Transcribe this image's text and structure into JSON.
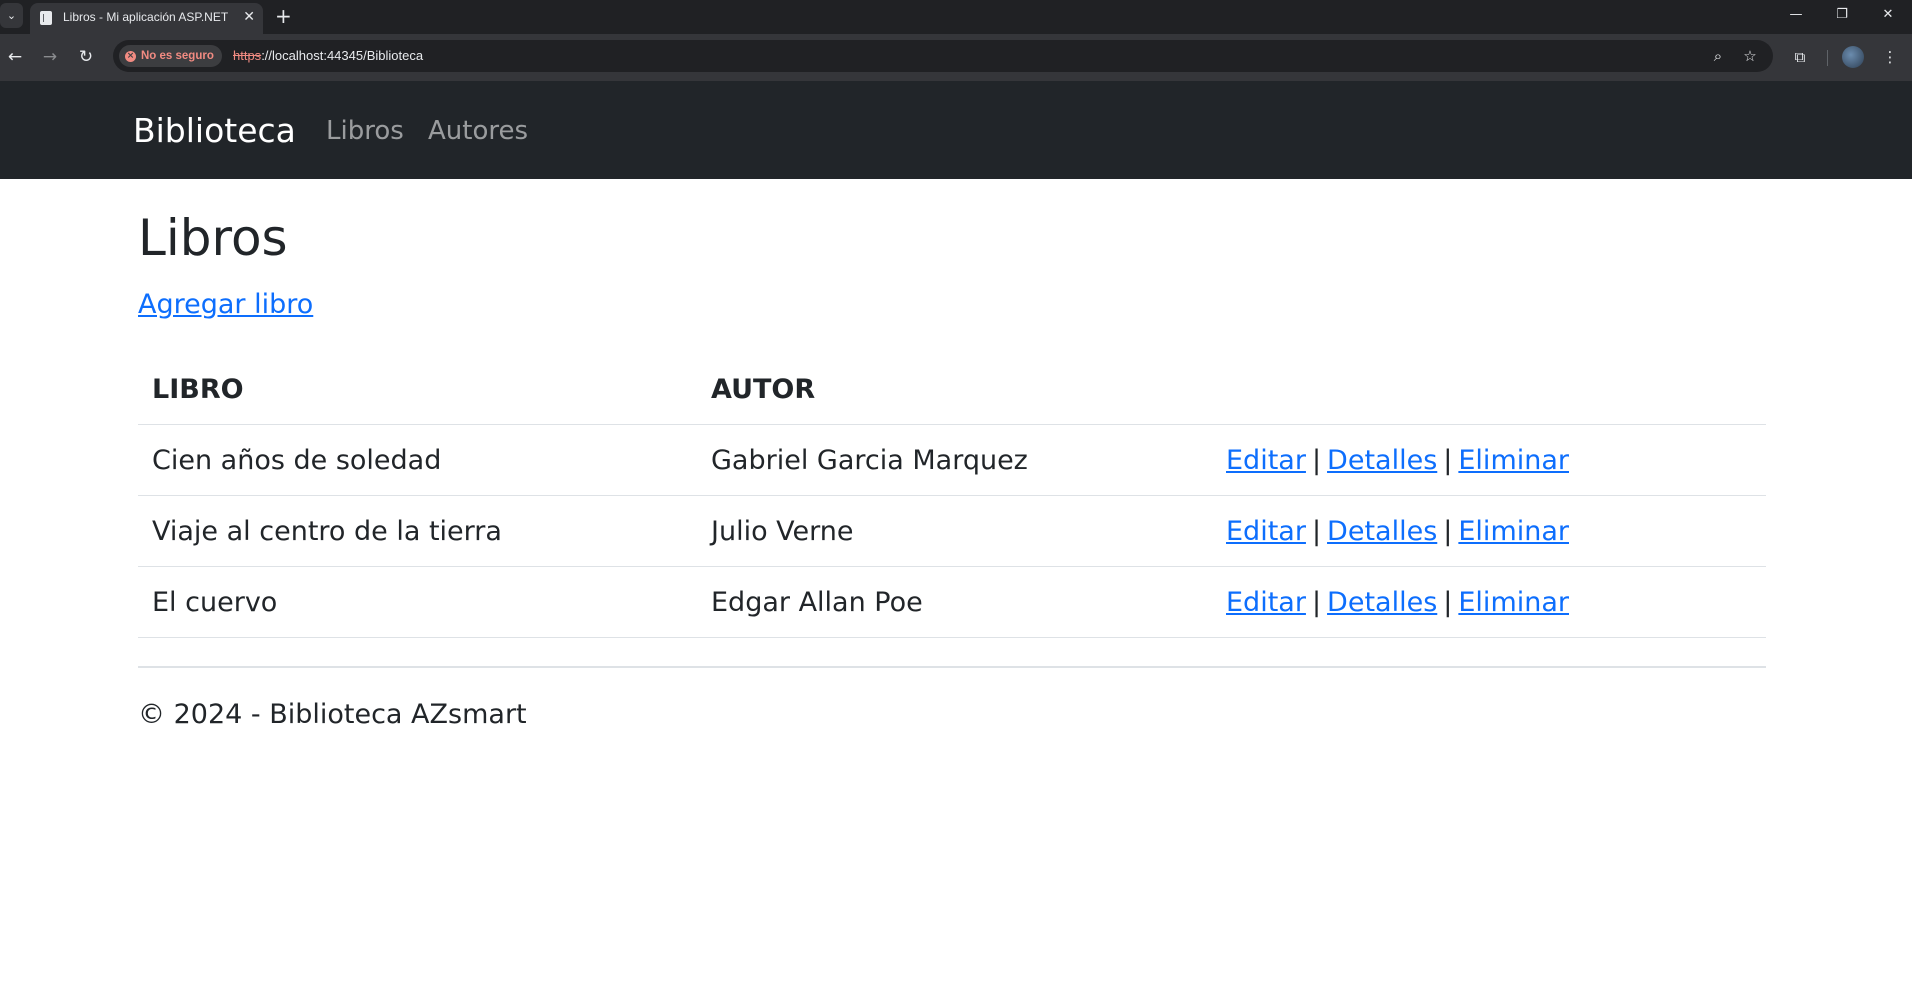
{
  "browser": {
    "tab_title": "Libros - Mi aplicación ASP.NET",
    "security_chip": "No es seguro",
    "url_scheme": "https",
    "url_rest": "://localhost:44345/Biblioteca"
  },
  "navbar": {
    "brand": "Biblioteca",
    "links": [
      "Libros",
      "Autores"
    ]
  },
  "page": {
    "title": "Libros",
    "add_link": "Agregar libro"
  },
  "table": {
    "headers": [
      "LIBRO",
      "AUTOR"
    ],
    "rows": [
      {
        "libro": "Cien años de soledad",
        "autor": "Gabriel Garcia Marquez"
      },
      {
        "libro": "Viaje al centro de la tierra",
        "autor": "Julio Verne"
      },
      {
        "libro": "El cuervo",
        "autor": "Edgar Allan Poe"
      }
    ],
    "actions": {
      "edit": "Editar",
      "details": "Detalles",
      "delete": "Eliminar",
      "separator": "|"
    }
  },
  "footer": {
    "text": "© 2024 - Biblioteca AZsmart"
  },
  "colors": {
    "navbar_bg": "#212529",
    "link": "#0d6efd",
    "chrome_dark": "#202124",
    "chrome_toolbar": "#35363a",
    "warning": "#f28b82"
  }
}
